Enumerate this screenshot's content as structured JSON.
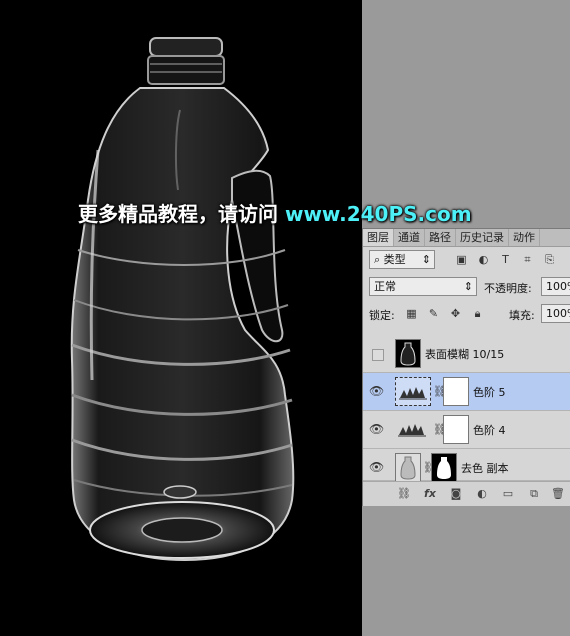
{
  "watermark": {
    "text": "更多精品教程，请访问",
    "url": "www.240PS.com"
  },
  "panel": {
    "tabs": [
      {
        "label": "图层",
        "active": true
      },
      {
        "label": "通道",
        "active": false
      },
      {
        "label": "路径",
        "active": false
      },
      {
        "label": "历史记录",
        "active": false
      },
      {
        "label": "动作",
        "active": false
      }
    ],
    "filter_select": "类型",
    "blend_mode": "正常",
    "opacity_label": "不透明度:",
    "opacity_value": "100%",
    "lock_label": "锁定:",
    "fill_label": "填充:",
    "fill_value": "100%",
    "layers": [
      {
        "name": "表面模糊 10/15",
        "visible": false,
        "selected": false,
        "type": "smart-filter"
      },
      {
        "name": "色阶 5",
        "visible": true,
        "selected": true,
        "type": "adjustment"
      },
      {
        "name": "色阶 4",
        "visible": true,
        "selected": false,
        "type": "adjustment"
      },
      {
        "name": "去色 副本",
        "visible": true,
        "selected": false,
        "type": "pixel-mask"
      }
    ]
  },
  "colors": {
    "accent_url": "#4ef0f7",
    "selection": "#b6cbf2",
    "workspace": "#9a9a9a"
  }
}
